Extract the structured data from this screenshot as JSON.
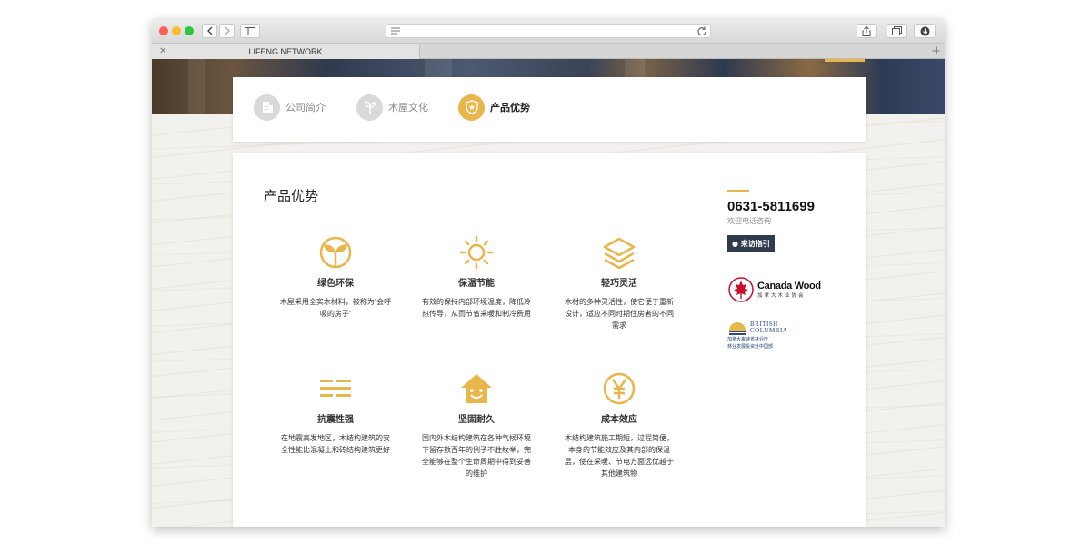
{
  "browser": {
    "tab_title": "LIFENG NETWORK",
    "tab_close": "✕",
    "new_tab": "+"
  },
  "subnav": {
    "items": [
      {
        "label": "公司简介",
        "icon": "building-icon",
        "active": false
      },
      {
        "label": "木屋文化",
        "icon": "sprout-icon",
        "active": false
      },
      {
        "label": "产品优势",
        "icon": "shield-icon",
        "active": true
      }
    ]
  },
  "content": {
    "title": "产品优势",
    "features": [
      {
        "title": "绿色环保",
        "desc": "木屋采用全实木材料，被称为'会呼吸的房子'",
        "icon": "leaf-icon"
      },
      {
        "title": "保温节能",
        "desc": "有效的保持内部环境温度，降低冷热传导，从而节省采暖和制冷费用",
        "icon": "sun-icon"
      },
      {
        "title": "轻巧灵活",
        "desc": "木材的多种灵活性，使它便于重新设计，适应不同时期住房者的不同需求",
        "icon": "layers-icon"
      },
      {
        "title": "抗震性强",
        "desc": "在地震高发地区，木结构建筑的安全性能比混凝土和砖结构建筑更好",
        "icon": "seismic-lines-icon"
      },
      {
        "title": "坚固耐久",
        "desc": "国内外木结构建筑在各种气候环境下留存数百年的例子不胜枚举，完全能够在整个生命周期中得到妥善的维护",
        "icon": "house-smile-icon"
      },
      {
        "title": "成本效应",
        "desc": "木结构建筑施工期短，过程简便，本身的节能效应及其内部的保温层，使在采暖、节电方面远优越于其他建筑物",
        "icon": "yen-coin-icon"
      }
    ]
  },
  "sidebar": {
    "phone": "0631-5811699",
    "phone_caption": "欢迎电话咨询",
    "visit_label": "来访指引",
    "canada_wood": {
      "name": "Canada Wood",
      "sub": "加拿大木业协会"
    },
    "bc": {
      "line1": "BRITISH",
      "line2": "COLUMBIA",
      "sub1": "加拿大卑诗省林业厅",
      "sub2": "林业发展投资处中国部"
    }
  },
  "colors": {
    "accent": "#e8b64a",
    "nav_inactive": "#d9d9d9",
    "dark_button": "#2f3b4c"
  }
}
